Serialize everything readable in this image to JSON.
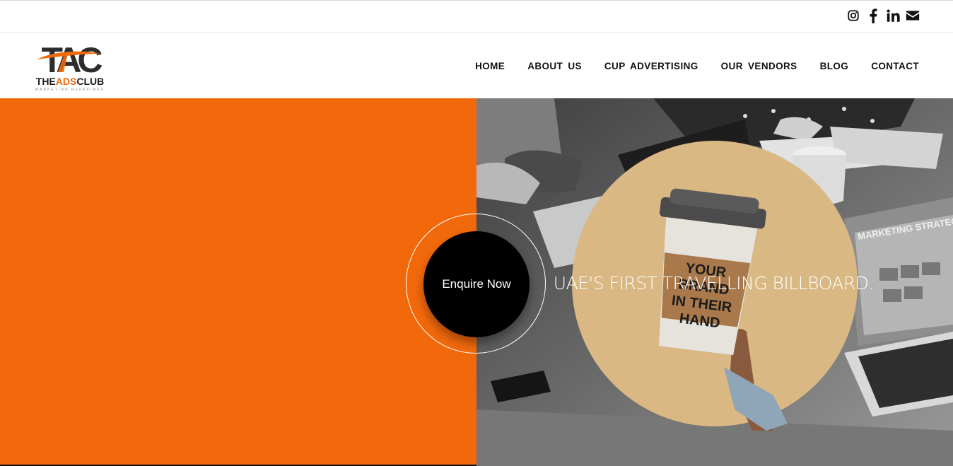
{
  "topbar": {
    "social": [
      {
        "icon": "instagram-icon"
      },
      {
        "icon": "facebook-icon"
      },
      {
        "icon": "linkedin-icon"
      },
      {
        "icon": "envelope-icon"
      }
    ]
  },
  "brand": {
    "logo_letters": "TAC",
    "name_part1": "THE",
    "name_part2": "ADS",
    "name_part3": "CLUB",
    "tagline": "MARKETING REDEFINED"
  },
  "nav": [
    "HOME",
    "ABOUT US",
    "CUP ADVERTISING",
    "OUR VENDORS",
    "BLOG",
    "CONTACT"
  ],
  "hero": {
    "title": "UAE'S FIRST TRAVELLING BILLBOARD.",
    "cta": "Enquire Now",
    "background_text": "MARKETING STRATEGY",
    "cup_text": [
      "YOUR",
      "BRAND",
      "IN THEIR",
      "HAND"
    ]
  },
  "colors": {
    "accent": "#f2690c",
    "cta_bg": "#000000",
    "kraft": "#d9b883"
  }
}
